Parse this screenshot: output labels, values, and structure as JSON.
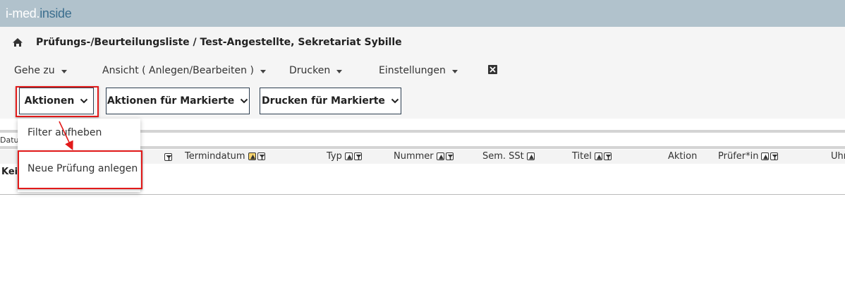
{
  "app": {
    "logo_part1": "i-med.",
    "logo_part2": "inside"
  },
  "breadcrumb": {
    "home_icon": "home-icon",
    "text": "Prüfungs-/Beurteilungsliste / Test-Angestellte, Sekretariat Sybille"
  },
  "menu": {
    "items": [
      {
        "label": "Gehe zu"
      },
      {
        "label": "Ansicht ( Anlegen/Bearbeiten )"
      },
      {
        "label": "Drucken"
      },
      {
        "label": "Einstellungen"
      }
    ]
  },
  "toolbar": {
    "aktionen": "Aktionen",
    "aktionen_markierte": "Aktionen für Markierte",
    "drucken_markierte": "Drucken für Markierte"
  },
  "dropdown": {
    "items": [
      {
        "label": "Filter aufheben"
      },
      {
        "label": "Neue Prüfung anlegen"
      }
    ]
  },
  "table": {
    "partial_label": "Datu",
    "columns": [
      {
        "label": "Termindatum"
      },
      {
        "label": "Typ"
      },
      {
        "label": "Nummer"
      },
      {
        "label": "Sem. SSt"
      },
      {
        "label": "Titel"
      },
      {
        "label": "Aktion"
      },
      {
        "label": "Prüfer*in"
      },
      {
        "label": "Uhr"
      }
    ],
    "empty_text": "Kei"
  },
  "colors": {
    "topbar": "#b1c2cc",
    "highlight": "#e21a1a",
    "logo_accent": "#3b6e8e",
    "sort_active": "#f7d46e"
  }
}
